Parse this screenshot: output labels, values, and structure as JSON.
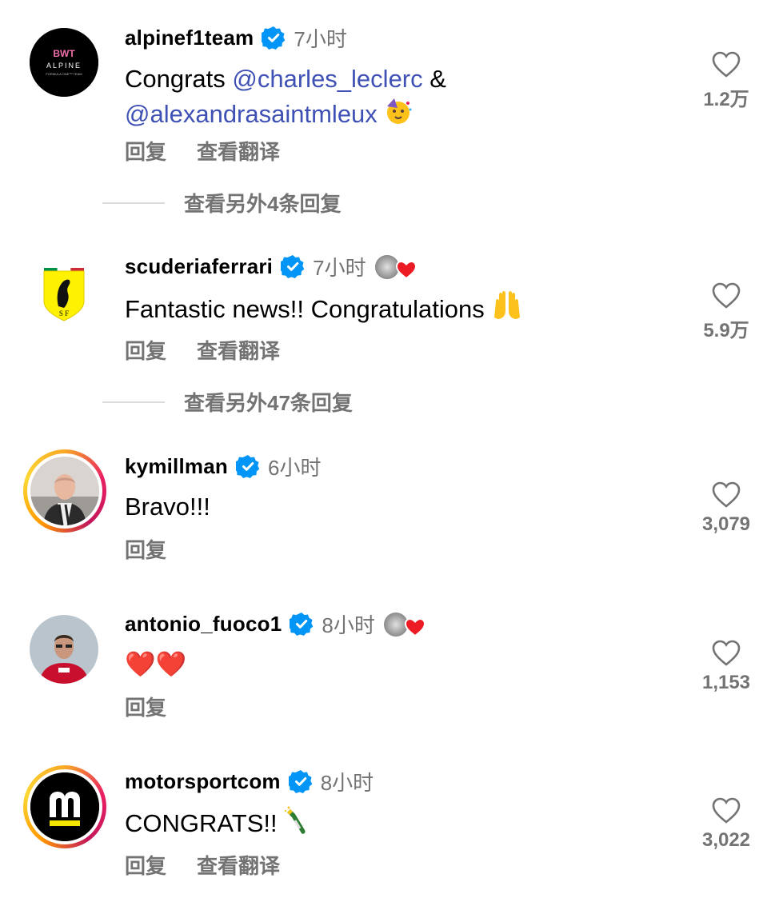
{
  "comments": [
    {
      "username": "alpinef1team",
      "time": "7小时",
      "text_prefix": "Congrats ",
      "mention1": "@charles_leclerc",
      "text_mid": " &",
      "mention2": "@alexandrasaintmleux",
      "emoji": "party-face",
      "reply": "回复",
      "translate": "查看翻译",
      "more_replies": "查看另外4条回复",
      "likes": "1.2万",
      "avatar_text_top": "BWT",
      "avatar_text_mid": "ALPINE",
      "avatar_text_bottom": "FORMULA ONE™ TEAM"
    },
    {
      "username": "scuderiaferrari",
      "time": "7小时",
      "text": "Fantastic news!! Congratulations",
      "emoji": "raising-hands",
      "reply": "回复",
      "translate": "查看翻译",
      "more_replies": "查看另外47条回复",
      "likes": "5.9万",
      "creator_liked": true
    },
    {
      "username": "kymillman",
      "time": "6小时",
      "text": "Bravo!!!",
      "reply": "回复",
      "likes": "3,079"
    },
    {
      "username": "antonio_fuoco1",
      "time": "8小时",
      "text": "❤️❤️",
      "reply": "回复",
      "likes": "1,153",
      "creator_liked": true
    },
    {
      "username": "motorsportcom",
      "time": "8小时",
      "text": "CONGRATS!!",
      "emoji": "champagne",
      "reply": "回复",
      "translate": "查看翻译",
      "likes": "3,022"
    }
  ],
  "colors": {
    "verified": "#0095f6",
    "mention": "#3f51b5",
    "secondary_text": "#737373",
    "heart_red": "#ed1c24"
  }
}
